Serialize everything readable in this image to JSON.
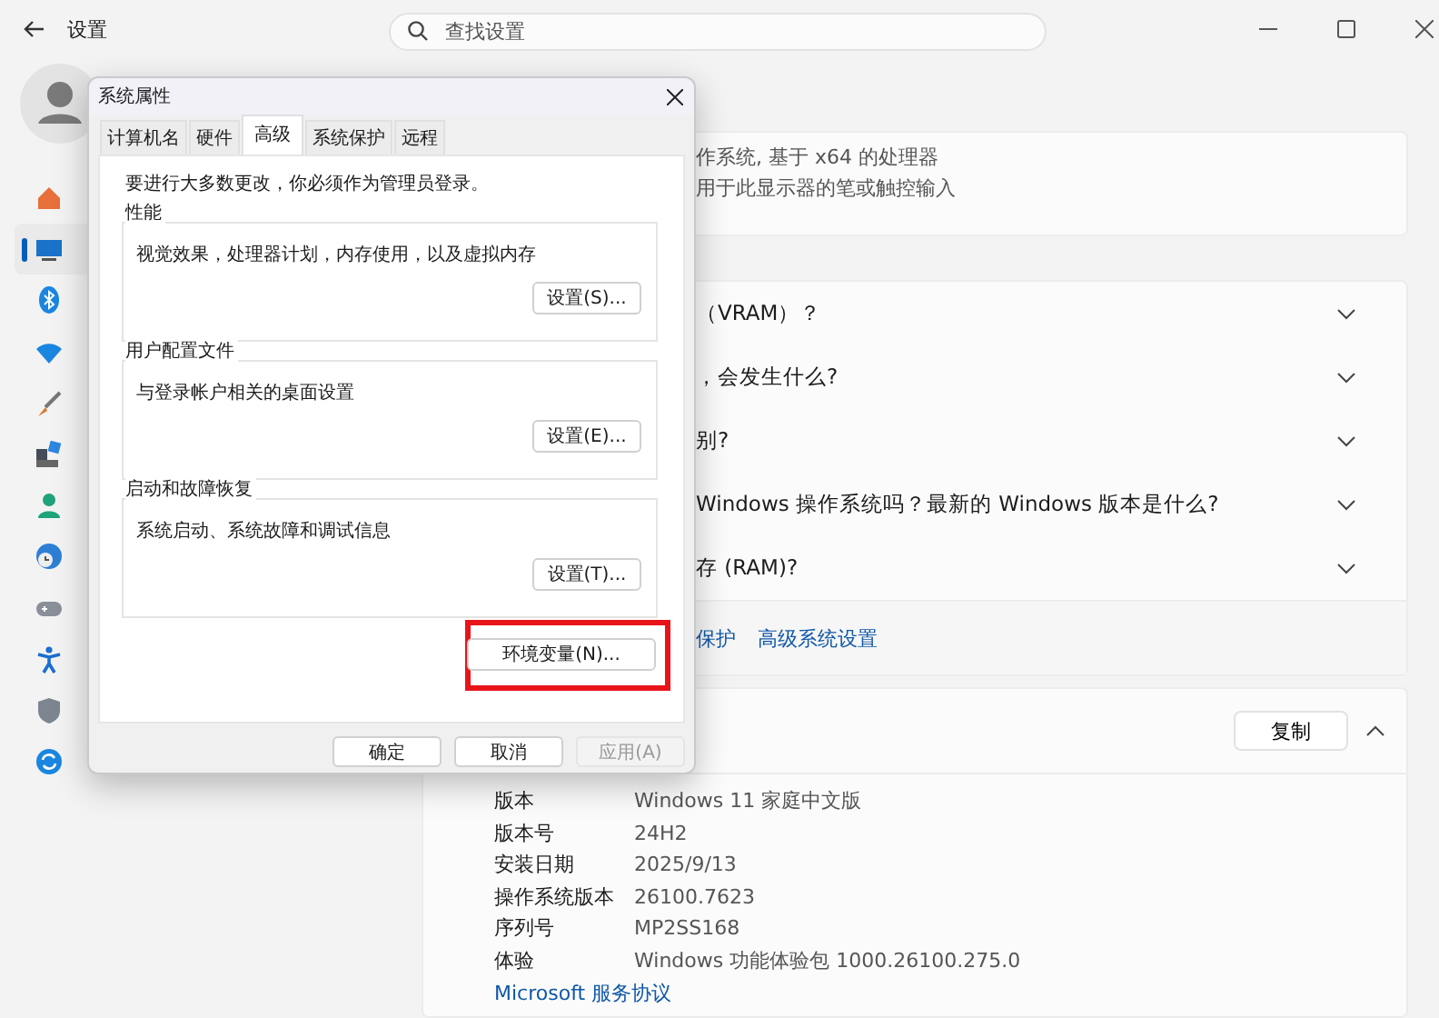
{
  "settings": {
    "title": "设置",
    "search": {
      "placeholder": "查找设置"
    },
    "sidebar": {
      "items": [
        {
          "kind": "home",
          "selected": false
        },
        {
          "kind": "system",
          "selected": true
        },
        {
          "kind": "bluetooth",
          "selected": false
        },
        {
          "kind": "network",
          "selected": false
        },
        {
          "kind": "brush",
          "selected": false
        },
        {
          "kind": "apps",
          "selected": false
        },
        {
          "kind": "account",
          "selected": false
        },
        {
          "kind": "time",
          "selected": false
        },
        {
          "kind": "gaming",
          "selected": false
        },
        {
          "kind": "accessibility",
          "selected": false
        },
        {
          "kind": "shield",
          "selected": false
        },
        {
          "kind": "update",
          "selected": false
        }
      ]
    },
    "specs": [
      "作系统, 基于 x64 的处理器",
      "用于此显示器的笔或触控输入"
    ],
    "faq": [
      "（VRAM）？",
      "，会发生什么?",
      "别?",
      "Windows 操作系统吗？最新的 Windows 版本是什么?",
      "存 (RAM)?"
    ],
    "related_links": [
      "保护",
      "高级系统设置"
    ],
    "windows_spec": {
      "copy_button": "复制",
      "rows": [
        {
          "label": "版本",
          "value": "Windows 11 家庭中文版"
        },
        {
          "label": "版本号",
          "value": "24H2"
        },
        {
          "label": "安装日期",
          "value": "2025/9/13"
        },
        {
          "label": "操作系统版本",
          "value": "26100.7623"
        },
        {
          "label": "序列号",
          "value": "MP2SS168"
        },
        {
          "label": "体验",
          "value": "Windows 功能体验包 1000.26100.275.0"
        }
      ],
      "link": "Microsoft 服务协议"
    }
  },
  "dialog": {
    "title": "系统属性",
    "tabs": [
      {
        "label": "计算机名",
        "selected": false
      },
      {
        "label": "硬件",
        "selected": false
      },
      {
        "label": "高级",
        "selected": true
      },
      {
        "label": "系统保护",
        "selected": false
      },
      {
        "label": "远程",
        "selected": false
      }
    ],
    "notice": "要进行大多数更改，你必须作为管理员登录。",
    "groups": [
      {
        "title": "性能",
        "description": "视觉效果，处理器计划，内存使用，以及虚拟内存",
        "button": "设置(S)..."
      },
      {
        "title": "用户配置文件",
        "description": "与登录帐户相关的桌面设置",
        "button": "设置(E)..."
      },
      {
        "title": "启动和故障恢复",
        "description": "系统启动、系统故障和调试信息",
        "button": "设置(T)..."
      }
    ],
    "env_button": "环境变量(N)...",
    "buttons": [
      {
        "label": "确定",
        "disabled": false
      },
      {
        "label": "取消",
        "disabled": false
      },
      {
        "label": "应用(A)",
        "disabled": true
      }
    ]
  }
}
